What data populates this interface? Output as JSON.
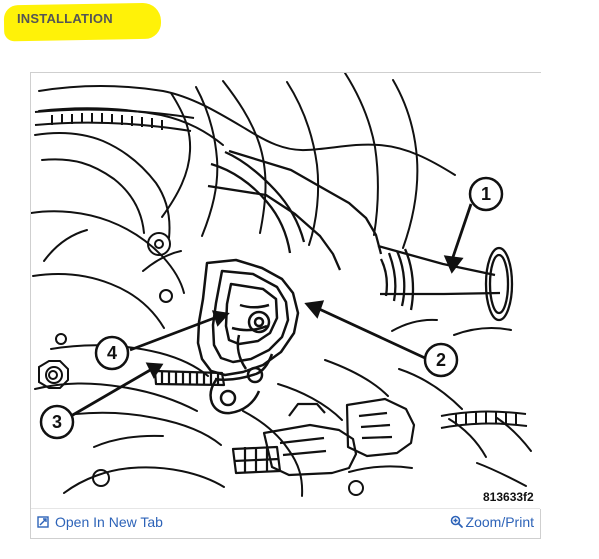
{
  "page": {
    "section_title": "INSTALLATION",
    "highlight_color": "#fff200",
    "link_color": "#2d63b8"
  },
  "figure": {
    "diagram_code": "813633f2",
    "callouts": [
      "1",
      "2",
      "3",
      "4"
    ],
    "actions": {
      "open_new_tab": "Open In New Tab",
      "zoom_print": "Zoom/Print"
    },
    "icons": {
      "open_new_tab": "open-in-new-tab-icon",
      "zoom_print": "zoom-icon"
    }
  }
}
